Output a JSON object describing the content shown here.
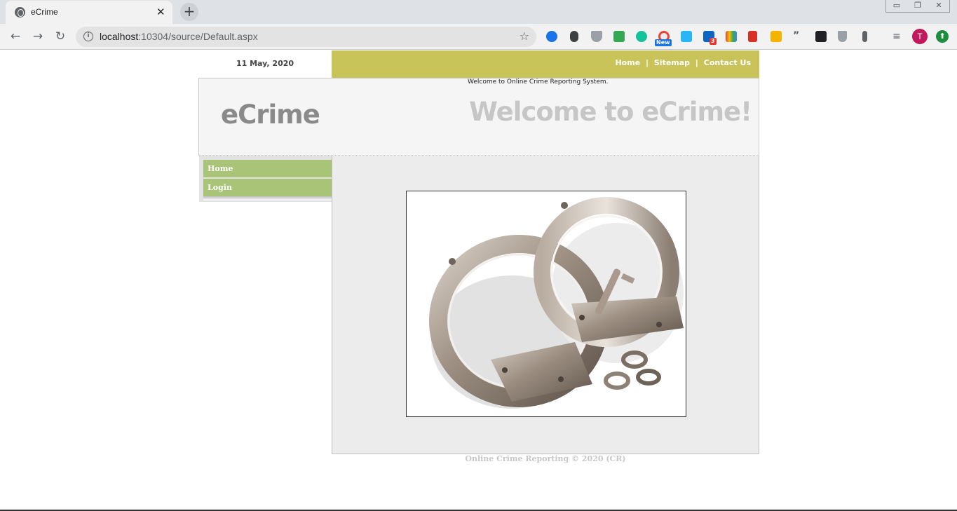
{
  "browser": {
    "tab_title": "eCrime",
    "tab_close": "✕",
    "new_tab": "+",
    "window_buttons": [
      "▭",
      "❐",
      "✕"
    ],
    "nav": {
      "back": "←",
      "forward": "→",
      "reload": "↻"
    },
    "url_host": "localhost",
    "url_path": ":10304/source/Default.aspx",
    "extensions": [
      "rocket-icon",
      "mouse-icon",
      "shield-icon",
      "printer-icon",
      "grammarly-icon",
      "new-badge-icon",
      "window-icon",
      "linkedin-icon",
      "palette-icon",
      "book-icon",
      "face-icon",
      "quote-icon",
      "lock-icon",
      "gray-shield-icon",
      "key-icon"
    ],
    "badge_new": "New",
    "badge_count": "3",
    "avatar_letter": "T",
    "update_arrow": "⬆",
    "reading_list": "≡"
  },
  "site": {
    "date": "11 May, 2020",
    "top_links": [
      "Home",
      "Sitemap",
      "Contact Us"
    ],
    "separator": "|",
    "tagline": "Welcome to Online Crime Reporting System.",
    "logo": "eCrime",
    "welcome": "Welcome to eCrime!",
    "menu": [
      "Home",
      "Login"
    ],
    "footer": "Online Crime Reporting © 2020 (CR)",
    "colors": {
      "nav_bar": "#c8c45a",
      "menu_item": "#a9c477",
      "content_bg": "#ececec"
    }
  }
}
